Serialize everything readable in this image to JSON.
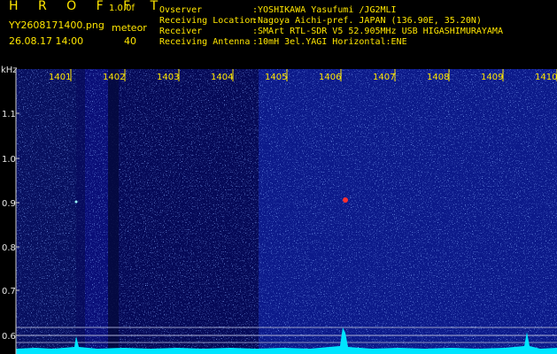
{
  "header": {
    "brand": "H R O F F T",
    "version": "1.0.0f",
    "filename": "YY2608171400.png",
    "meteor_label": "meteor",
    "datetime": "26.08.17 14:00",
    "meteor_count": "40",
    "info": [
      {
        "label": "Ovserver",
        "value": ":YOSHIKAWA Yasufumi /JG2MLI"
      },
      {
        "label": "Receiving Location",
        "value": ":Nagoya Aichi-pref. JAPAN (136.90E, 35.20N)"
      },
      {
        "label": "Receiver",
        "value": ":SMArt RTL-SDR V5 52.905MHz USB HIGASHIMURAYAMA"
      },
      {
        "label": "Receiving Antenna",
        "value": ":10mH 3el.YAGI Horizontal:ENE"
      }
    ]
  },
  "axis": {
    "y_unit": "kHz",
    "y_ticks": [
      "1.1",
      "1.0",
      "0.9",
      "0.8",
      "0.7",
      "0.6"
    ],
    "x_ticks": [
      "1401",
      "1402",
      "1403",
      "1404",
      "1405",
      "1406",
      "1407",
      "1408",
      "1409",
      "1410"
    ]
  },
  "colors": {
    "background": "#000000",
    "spectrum_base": "#0a0f78",
    "noise_bright": "#3d6cff",
    "signal": "#00e5ff",
    "meteor_head": "#ff3030",
    "text": "#ffe600",
    "axis_text": "#e8e8e8"
  }
}
